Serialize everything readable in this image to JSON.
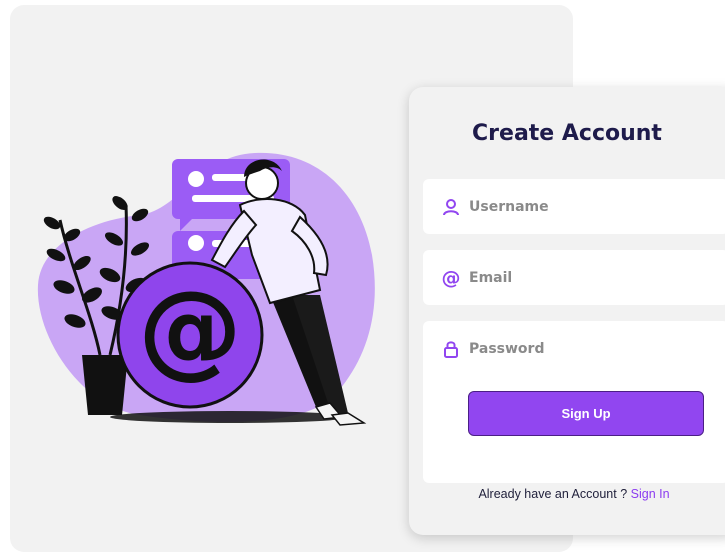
{
  "form": {
    "title": "Create Account",
    "username_placeholder": "Username",
    "email_placeholder": "Email",
    "password_placeholder": "Password",
    "signup_label": "Sign Up",
    "footer_text": "Already have an Account ?",
    "signin_link": "Sign In"
  },
  "icons": {
    "username": "user-icon",
    "email": "at-icon",
    "password": "lock-icon"
  },
  "colors": {
    "accent": "#9146f0",
    "button_border": "#4b1f86",
    "title": "#1e1b4b",
    "panel_bg": "#f2f2f2",
    "blob": "#c9a6f5"
  }
}
